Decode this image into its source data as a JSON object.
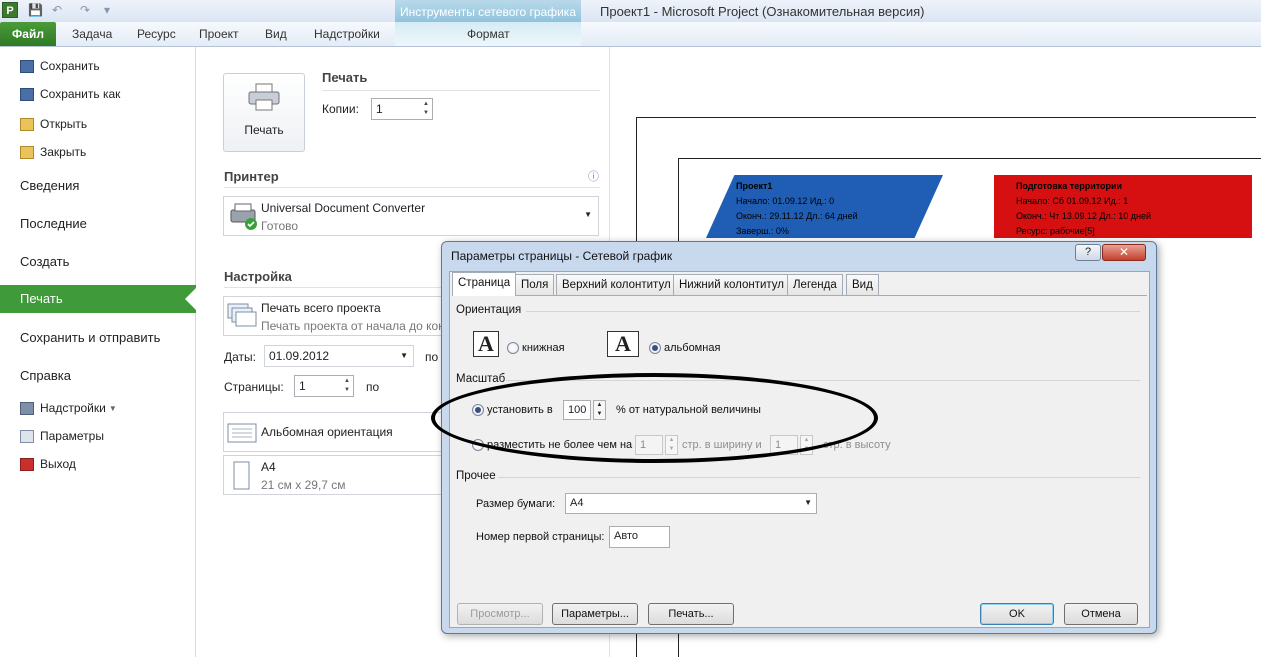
{
  "window": {
    "title": "Проект1 - Microsoft Project (Ознакомительная версия)",
    "app_icon_letter": "P"
  },
  "ribbon": {
    "context_group": "Инструменты сетевого графика",
    "tabs": [
      "Файл",
      "Задача",
      "Ресурс",
      "Проект",
      "Вид",
      "Надстройки"
    ],
    "context_tab": "Формат"
  },
  "backstage": {
    "commands": [
      "Сохранить",
      "Сохранить как",
      "Открыть",
      "Закрыть"
    ],
    "sections": [
      "Сведения",
      "Последние",
      "Создать",
      "Печать",
      "Сохранить и отправить",
      "Справка"
    ],
    "selected": "Печать",
    "bottom": [
      "Надстройки",
      "Параметры",
      "Выход"
    ]
  },
  "print": {
    "button": "Печать",
    "heading": "Печать",
    "copies_label": "Копии:",
    "copies": "1",
    "printer_heading": "Принтер",
    "printer_name": "Universal Document Converter",
    "printer_status": "Готово",
    "settings_heading": "Настройка",
    "scope_title": "Печать всего проекта",
    "scope_sub": "Печать проекта от начала до кон",
    "dates_label": "Даты:",
    "date_from": "01.09.2012",
    "date_to_label": "по",
    "pages_label": "Страницы:",
    "page_from": "1",
    "page_to_label": "по",
    "orientation": "Альбомная ориентация",
    "paper": "A4",
    "paper_size": "21 см x 29,7 см"
  },
  "preview": {
    "node1": {
      "name": "Проект1",
      "start": "Начало:  01.09.12   Ид.:    0",
      "finish": "Оконч.: 29.11.12   Дл.: 64 дней",
      "done": "Заверш.: 0%"
    },
    "node2": {
      "name": "Подготовка территории",
      "start": "Начало:  Сб 01.09.12   Ид.:     1",
      "finish": "Оконч.:  Чт 13.09.12    Дл.: 10 дней",
      "resource": "Ресурс:     рабочие[5]"
    }
  },
  "dialog": {
    "title": "Параметры страницы - Сетевой график",
    "help": "?",
    "tabs": [
      "Страница",
      "Поля",
      "Верхний колонтитул",
      "Нижний колонтитул",
      "Легенда",
      "Вид"
    ],
    "orientation_group": "Ориентация",
    "portrait": "книжная",
    "landscape": "альбомная",
    "scale_group": "Масштаб",
    "set_to": "установить в",
    "scale_value": "100",
    "scale_suffix": "% от натуральной величины",
    "fit_to": "разместить не более чем на",
    "fit_wide": "1",
    "fit_wide_suffix": "стр. в ширину и",
    "fit_tall": "1",
    "fit_tall_suffix": "стр. в высоту",
    "other_group": "Прочее",
    "paper_label": "Размер бумаги:",
    "paper_value": "A4",
    "first_page_label": "Номер первой страницы:",
    "first_page_value": "Авто",
    "btn_preview": "Просмотр...",
    "btn_options": "Параметры...",
    "btn_print": "Печать...",
    "btn_ok": "OK",
    "btn_cancel": "Отмена"
  },
  "colors": {
    "file_tab": "#2f7a26",
    "selected": "#3f9a3a",
    "node1": "#1f5eb4",
    "node2": "#d61010"
  }
}
